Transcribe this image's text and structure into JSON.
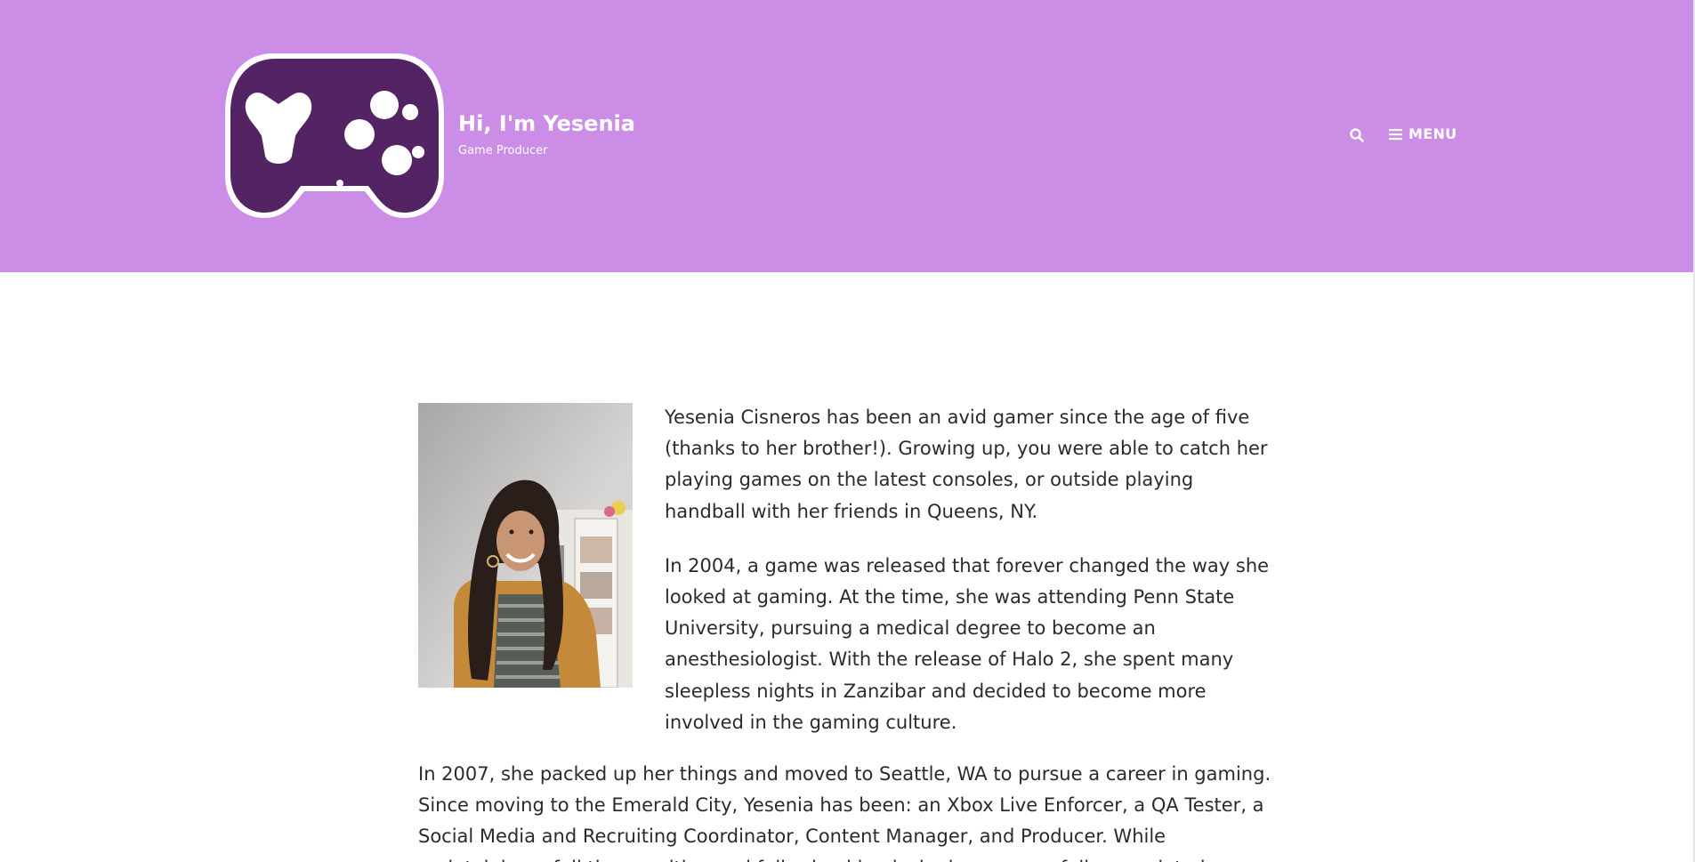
{
  "header": {
    "title": "Hi, I'm Yesenia",
    "tagline": "Game Producer",
    "menu_label": "MENU",
    "background_color": "#cc8de6",
    "logo_color": "#542363",
    "logo_icon": "game-controller-logo",
    "search_icon": "search-icon",
    "menu_icon": "hamburger-icon"
  },
  "main": {
    "portrait_alt": "Photo of Yesenia Cisneros",
    "paragraphs": [
      "Yesenia Cisneros has been an avid gamer since the age of five (thanks to her brother!). Growing up, you were able to catch her playing games on the latest consoles, or outside playing handball with her friends in Queens, NY.",
      "In 2004, a game was released that forever changed the way she looked at gaming. At the time, she was attending Penn State University, pursuing a medical degree to become an anesthesiologist. With the release of Halo 2, she spent many sleepless nights in Zanzibar and decided to become more involved in the gaming culture.",
      "In 2007, she packed up her things and moved to Seattle, WA to pursue a career in gaming. Since moving to the Emerald City, Yesenia has been: an Xbox Live Enforcer, a QA Tester, a Social Media and Recruiting Coordinator, Content Manager, and Producer. While maintaining a full time position and full school load, she has successfully completed a"
    ]
  }
}
